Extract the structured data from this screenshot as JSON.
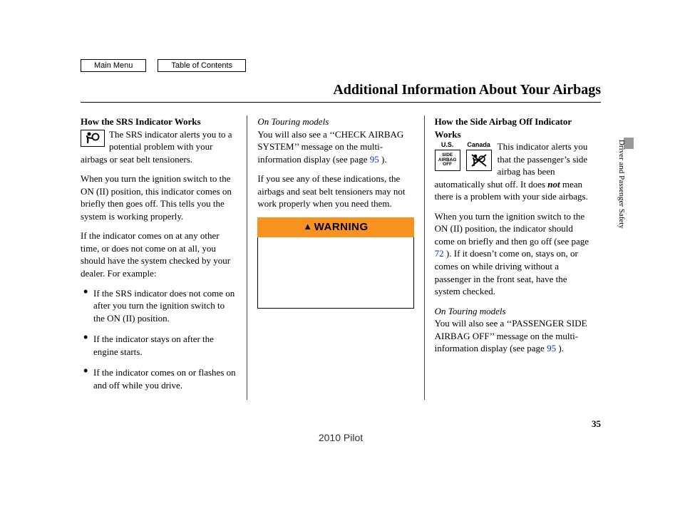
{
  "nav": {
    "main_menu": "Main Menu",
    "toc": "Table of Contents"
  },
  "title": "Additional Information About Your Airbags",
  "side_tab": "Driver and Passenger Safety",
  "page_number": "35",
  "footer_model": "2010 Pilot",
  "col1": {
    "h1": "How the SRS Indicator Works",
    "srs_icon_alt": "SRS",
    "p1": "The SRS indicator alerts you to a potential problem with your airbags or seat belt tensioners.",
    "p2": "When you turn the ignition switch to the ON (II) position, this indicator comes on briefly then goes off. This tells you the system is working properly.",
    "p3": "If the indicator comes on at any other time, or does not come on at all, you should have the system checked by your dealer. For example:",
    "li1": "If the SRS indicator does not come on after you turn the ignition switch to the ON (II) position.",
    "li2": "If the indicator stays on after the engine starts.",
    "li3": "If the indicator comes on or flashes on and off while you drive."
  },
  "col2": {
    "note": "On Touring models",
    "p1a": "You will also see a ‘‘CHECK AIRBAG SYSTEM’’ message on the multi-information display (see page ",
    "p1_link": "95",
    "p1b": " ).",
    "p2": "If you see any of these indications, the airbags and seat belt tensioners may not work properly when you need them.",
    "warn_label": "WARNING"
  },
  "col3": {
    "h1": "How the Side Airbag Off Indicator Works",
    "region_us": "U.S.",
    "region_ca": "Canada",
    "us_icon_text": "SIDE\nAIRBAG\nOFF",
    "p1a": "This indicator alerts you that the passenger’s side airbag has been automatically shut off. It does ",
    "p1_not": "not",
    "p1b": " mean there is a problem with your side airbags.",
    "p2a": "When you turn the ignition switch to the ON (II) position, the indicator should come on briefly and then go off (see page ",
    "p2_link": "72",
    "p2b": " ). If it doesn’t come on, stays on, or comes on while driving without a passenger in the front seat, have the system checked.",
    "note": "On Touring models",
    "p3a": "You will also see a ‘‘PASSENGER SIDE AIRBAG OFF’’ message on the multi-information display (see page ",
    "p3_link": "95",
    "p3b": " )."
  }
}
